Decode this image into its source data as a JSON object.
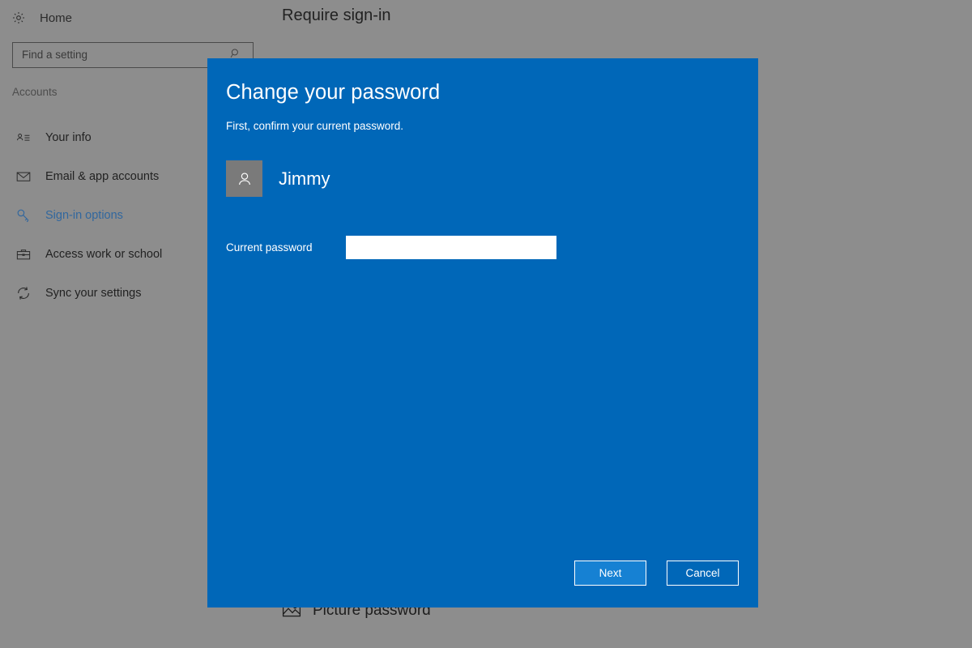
{
  "app": {
    "home_label": "Home",
    "home_icon": "gear-icon",
    "section_title": "Accounts"
  },
  "search": {
    "placeholder": "Find a setting",
    "value": "Find a setting",
    "icon": "search-icon"
  },
  "sidebar": {
    "items": [
      {
        "label": "Your info",
        "icon": "contact-card-icon",
        "selected": false
      },
      {
        "label": "Email & app accounts",
        "icon": "envelope-icon",
        "selected": false
      },
      {
        "label": "Sign-in options",
        "icon": "key-icon",
        "selected": true
      },
      {
        "label": "Access work or school",
        "icon": "briefcase-icon",
        "selected": false
      },
      {
        "label": "Sync your settings",
        "icon": "sync-icon",
        "selected": false
      }
    ]
  },
  "main": {
    "heading": "Require sign-in",
    "picture_password_label": "Picture password",
    "picture_password_icon": "picture-icon"
  },
  "dialog": {
    "title": "Change your password",
    "subtitle": "First, confirm your current password.",
    "account_name": "Jimmy",
    "avatar_icon": "person-icon",
    "password_label": "Current password",
    "password_value": "",
    "password_placeholder": "",
    "next_label": "Next",
    "cancel_label": "Cancel"
  },
  "colors": {
    "dialog_blue": "#0067b8",
    "primary_button_blue": "#1681d3",
    "backdrop_gray": "#8d8d8d",
    "selected_nav_blue": "#31679e"
  }
}
